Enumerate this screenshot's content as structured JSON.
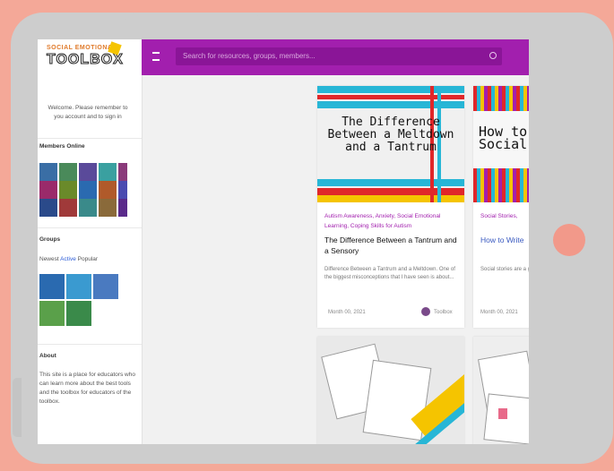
{
  "brand": {
    "logo_top": "SOCIAL EMOTIONAL",
    "logo_main": "TOOLBOX"
  },
  "header": {
    "search_placeholder": "Search for resources, groups, members..."
  },
  "sidebar": {
    "welcome": "Welcome. Please remember to you account and to sign in",
    "members_title": "Members Online",
    "groups_title": "Groups",
    "follow_prefix": "Newest",
    "follow_link": "Active",
    "follow_suffix": "Popular",
    "about_title": "About",
    "about_text": "This site is a place for educators who can learn more about the best tools and the toolbox for educators of the toolbox."
  },
  "cards": [
    {
      "cover_title": "The Difference Between a Meltdown and a Tantrum",
      "categories": "Autism Awareness, Anxiety, Social Emotional Learning, Coping Skills for Autism",
      "title": "The Difference Between a Tantrum and a Sensory",
      "description": "Difference Between a Tantrum and a Meltdown. One of the biggest misconceptions that I have seen is about...",
      "date": "Month 00, 2021",
      "author": "Toolbox"
    },
    {
      "cover_title": "How to Teach Social",
      "categories": "Social Stories,",
      "title": "How to Write",
      "description": "Social stories are a great tool to teach social skills...",
      "date": "Month 00, 2021"
    }
  ],
  "colors": {
    "accent": "#a21fae",
    "background": "#f4a898",
    "tablet": "#cdcdcd"
  }
}
